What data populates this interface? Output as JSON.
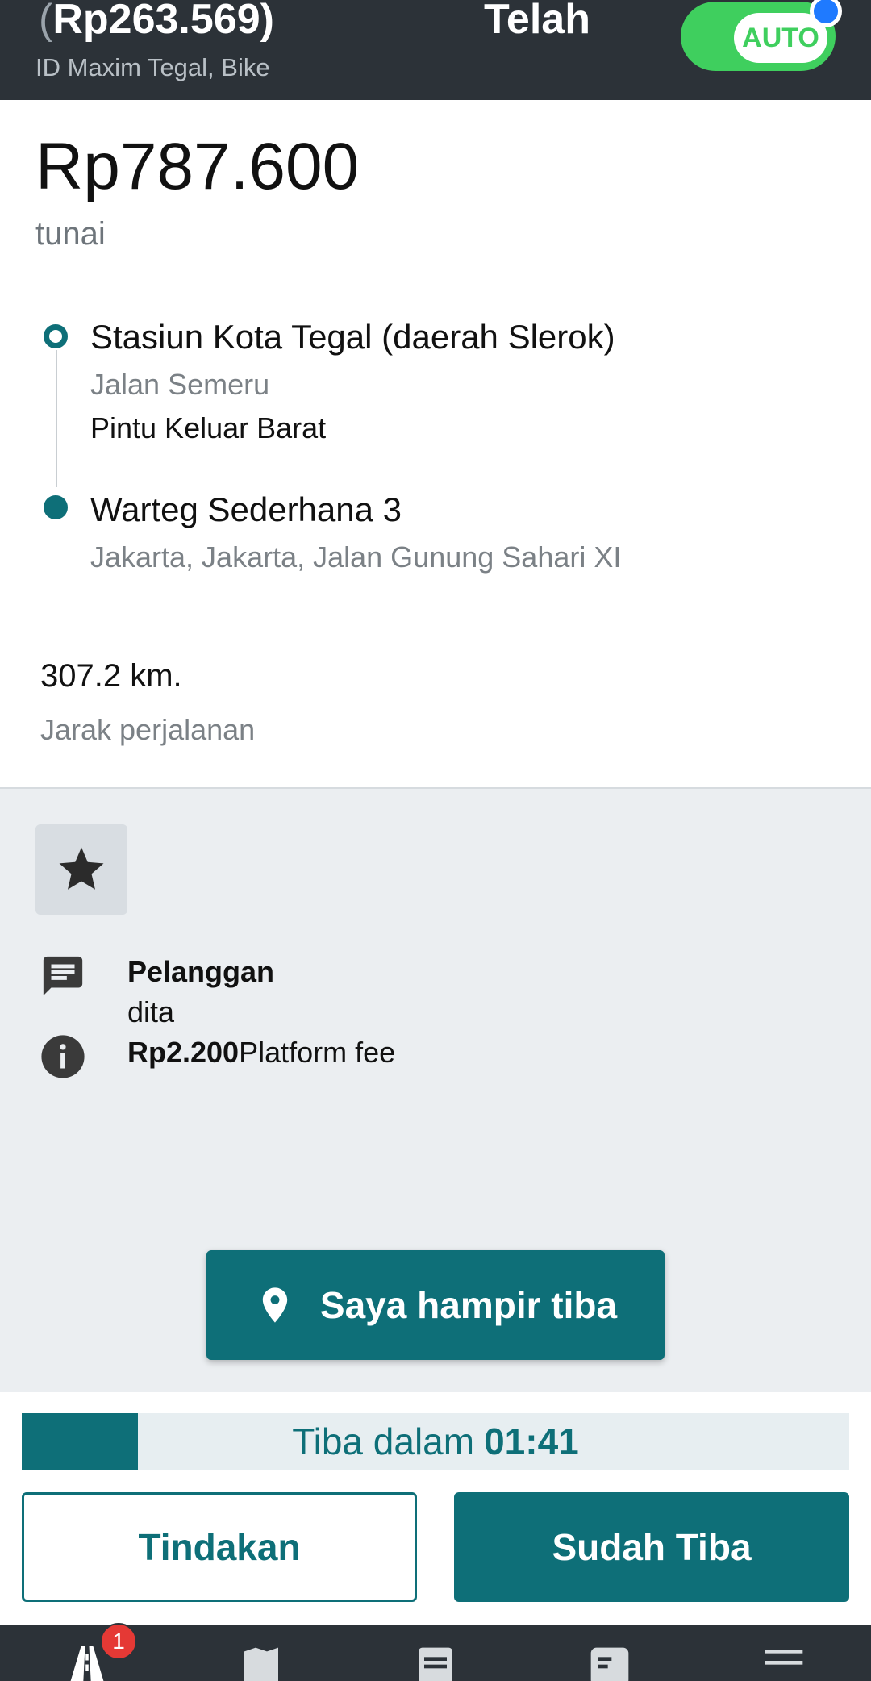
{
  "header": {
    "balance_paren_open": "(",
    "balance": "Rp263.569)",
    "subtitle": "ID Maxim Tegal, Bike",
    "status": "Telah",
    "auto_label": "AUTO"
  },
  "order": {
    "price": "Rp787.600",
    "payment_method": "tunai",
    "pickup": {
      "title": "Stasiun Kota Tegal (daerah Slerok)",
      "street": "Jalan Semeru",
      "note": "Pintu Keluar Barat"
    },
    "destination": {
      "title": "Warteg Sederhana 3",
      "address": "Jakarta, Jakarta, Jalan Gunung Sahari XI"
    },
    "distance": "307.2 km.",
    "distance_label": "Jarak perjalanan"
  },
  "customer": {
    "label": "Pelanggan",
    "name": "dita",
    "fee_amount": "Rp2.200",
    "fee_label": "Platform fee"
  },
  "actions": {
    "almost_arrived": "Saya hampir tiba",
    "timer_prefix": "Tiba dalam",
    "timer_value": "01:41",
    "timer_progress": 0.14,
    "tindakan": "Tindakan",
    "sudah_tiba": "Sudah Tiba"
  },
  "nav": {
    "badge_count": "1"
  },
  "colors": {
    "primary": "#0e6f78",
    "header_bg": "#2c3238",
    "toggle_green": "#3fcf5e",
    "badge_red": "#e53935"
  },
  "icons": [
    "star-icon",
    "message-icon",
    "info-icon",
    "location-pin-icon",
    "road-icon",
    "map-icon",
    "orders-icon",
    "chat-icon",
    "menu-icon"
  ]
}
